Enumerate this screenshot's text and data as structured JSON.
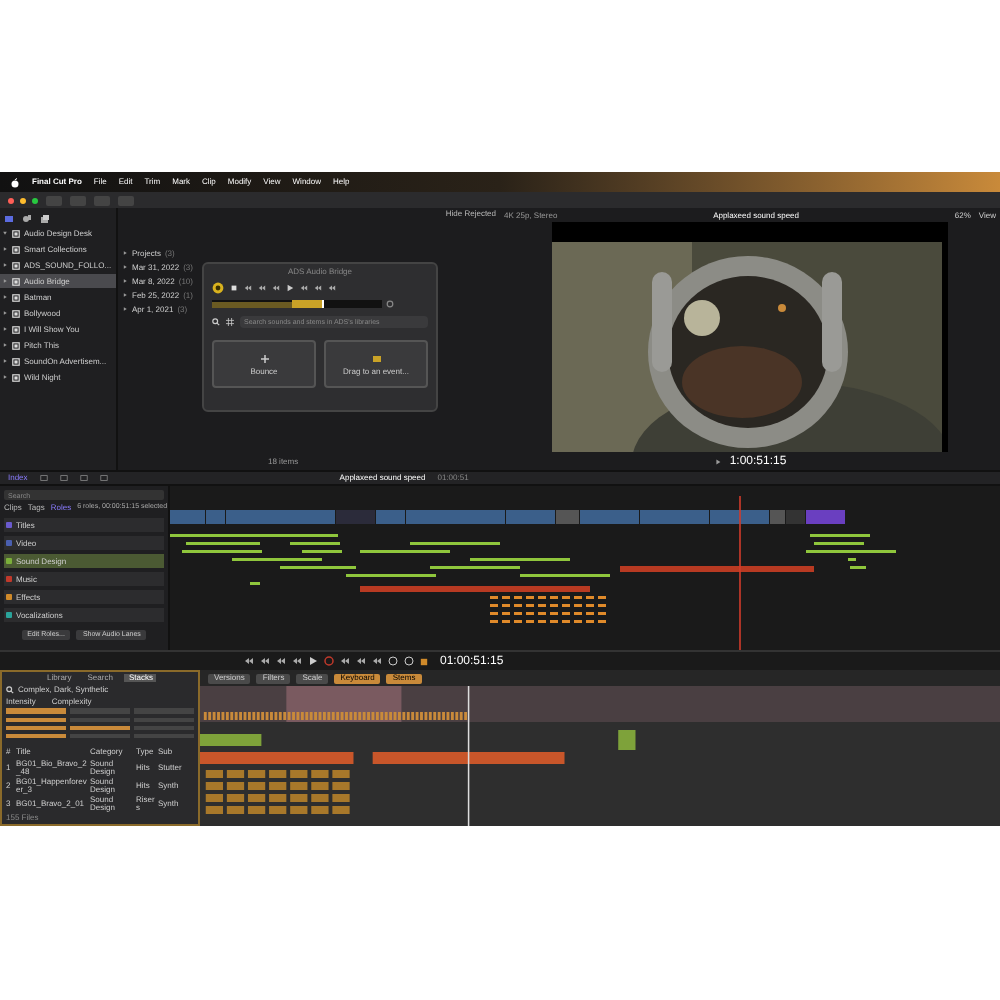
{
  "menu_bar": {
    "app": "Final Cut Pro",
    "items": [
      "File",
      "Edit",
      "Trim",
      "Mark",
      "Clip",
      "Modify",
      "View",
      "Window",
      "Help"
    ]
  },
  "libraries": [
    {
      "label": "Audio Design Desk",
      "expanded": true,
      "selected": false
    },
    {
      "label": "Smart Collections",
      "expanded": false,
      "selected": false
    },
    {
      "label": "ADS_SOUND_FOLLO...",
      "expanded": false,
      "selected": false
    },
    {
      "label": "Audio Bridge",
      "expanded": false,
      "selected": true
    },
    {
      "label": "Batman",
      "expanded": false,
      "selected": false
    },
    {
      "label": "Bollywood",
      "expanded": false,
      "selected": false
    },
    {
      "label": "I Will Show You",
      "expanded": false,
      "selected": false
    },
    {
      "label": "Pitch This",
      "expanded": false,
      "selected": false
    },
    {
      "label": "SoundOn Advertisem...",
      "expanded": false,
      "selected": false
    },
    {
      "label": "Wild Night",
      "expanded": false,
      "selected": false
    }
  ],
  "events": [
    {
      "label": "Projects",
      "count": "(3)"
    },
    {
      "label": "Mar 31, 2022",
      "count": "(3)"
    },
    {
      "label": "Mar 8, 2022",
      "count": "(10)"
    },
    {
      "label": "Feb 25, 2022",
      "count": "(1)"
    },
    {
      "label": "Apr 1, 2021",
      "count": "(3)"
    }
  ],
  "browser": {
    "filter": "Hide Rejected",
    "item_count": "18 items"
  },
  "audio_bridge": {
    "title": "ADS Audio Bridge",
    "search_placeholder": "Search sounds and stems in ADS's libraries",
    "tiles": [
      "Bounce",
      "Drag to an event..."
    ]
  },
  "viewer": {
    "format": "4K 25p, Stereo",
    "project": "Applaxeed sound speed",
    "zoom": "62%",
    "view": "View",
    "timecode": "1:00:51:15"
  },
  "timeline_toolbar": {
    "index": "Index",
    "project": "Applaxeed sound speed",
    "duration": "01:00:51"
  },
  "timeline_index": {
    "search_placeholder": "Search",
    "tabs": [
      {
        "label": "Clips",
        "selected": false
      },
      {
        "label": "Tags",
        "selected": false
      },
      {
        "label": "Roles",
        "selected": true
      }
    ],
    "summary": "6 roles, 00:00:51:15 selected",
    "roles": [
      {
        "label": "Titles",
        "color": "#6a5acd",
        "selected": false
      },
      {
        "label": "Video",
        "color": "#4a5fb0",
        "selected": false
      },
      {
        "label": "Sound Design",
        "color": "#7bb03a",
        "selected": true
      },
      {
        "label": "Music",
        "color": "#c0392b",
        "selected": false
      },
      {
        "label": "Effects",
        "color": "#d08a2a",
        "selected": false
      },
      {
        "label": "Vocalizations",
        "color": "#2aa39a",
        "selected": false
      }
    ],
    "buttons": [
      "Edit Roles...",
      "Show Audio Lanes"
    ]
  },
  "transport": {
    "timecode": "01:00:51:15"
  },
  "stack_panel": {
    "tabs": [
      {
        "label": "Library",
        "selected": false
      },
      {
        "label": "Search",
        "selected": false
      },
      {
        "label": "Stacks",
        "selected": true
      }
    ],
    "query": "Complex, Dark, Synthetic",
    "intensity": "Intensity",
    "complexity": "Complexity",
    "columns": [
      "#",
      "Title",
      "Category",
      "Type",
      "Sub"
    ],
    "rows": [
      [
        "1",
        "BG01_Bio_Bravo_2_48",
        "Sound Design",
        "Hits",
        "Stutter"
      ],
      [
        "2",
        "BG01_Happenforever_3",
        "Sound Design",
        "Hits",
        "Synth"
      ],
      [
        "3",
        "BG01_Bravo_2_01",
        "Sound Design",
        "Risers",
        "Synth"
      ]
    ],
    "footer": "155 Files"
  },
  "ads_toolbar": [
    "Versions",
    "Filters",
    "Scale",
    "Keyboard",
    "Stems"
  ]
}
